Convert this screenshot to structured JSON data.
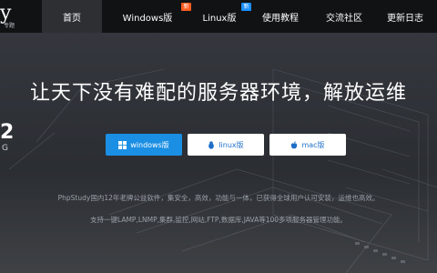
{
  "brand": {
    "logo_text": "y",
    "logo_sub": "专题"
  },
  "nav": {
    "items": [
      {
        "label": "首页",
        "active": true,
        "badge": null
      },
      {
        "label": "Windows版",
        "active": false,
        "badge": "新",
        "badge_color": "#ff5a1f"
      },
      {
        "label": "Linux版",
        "active": false,
        "badge": "新",
        "badge_color": "#1a8fff"
      },
      {
        "label": "使用教程",
        "active": false,
        "badge": null
      },
      {
        "label": "交流社区",
        "active": false,
        "badge": null
      },
      {
        "label": "更新日志",
        "active": false,
        "badge": null
      }
    ]
  },
  "hero": {
    "headline": "让天下没有难配的服务器环境，解放运维",
    "left_deco": "2",
    "left_deco_sub": "G"
  },
  "buttons": {
    "windows": {
      "label": "windows版",
      "icon": "windows-icon"
    },
    "linux": {
      "label": "linux版",
      "icon": "linux-icon"
    },
    "mac": {
      "label": "mac版",
      "icon": "apple-icon"
    }
  },
  "description": {
    "line1": "PhpStudy国内12年老牌公益软件，集安全，高效，功能与一体，已获得全球用户认可安装，运维也高效。",
    "line2": "支持一键LAMP,LNMP,集群,监控,网站,FTP,数据库,JAVA等100多项服务器管理功能。"
  },
  "colors": {
    "accent": "#1b8fe3",
    "topbar": "#111214",
    "hero_bg": "#2c2f34"
  }
}
